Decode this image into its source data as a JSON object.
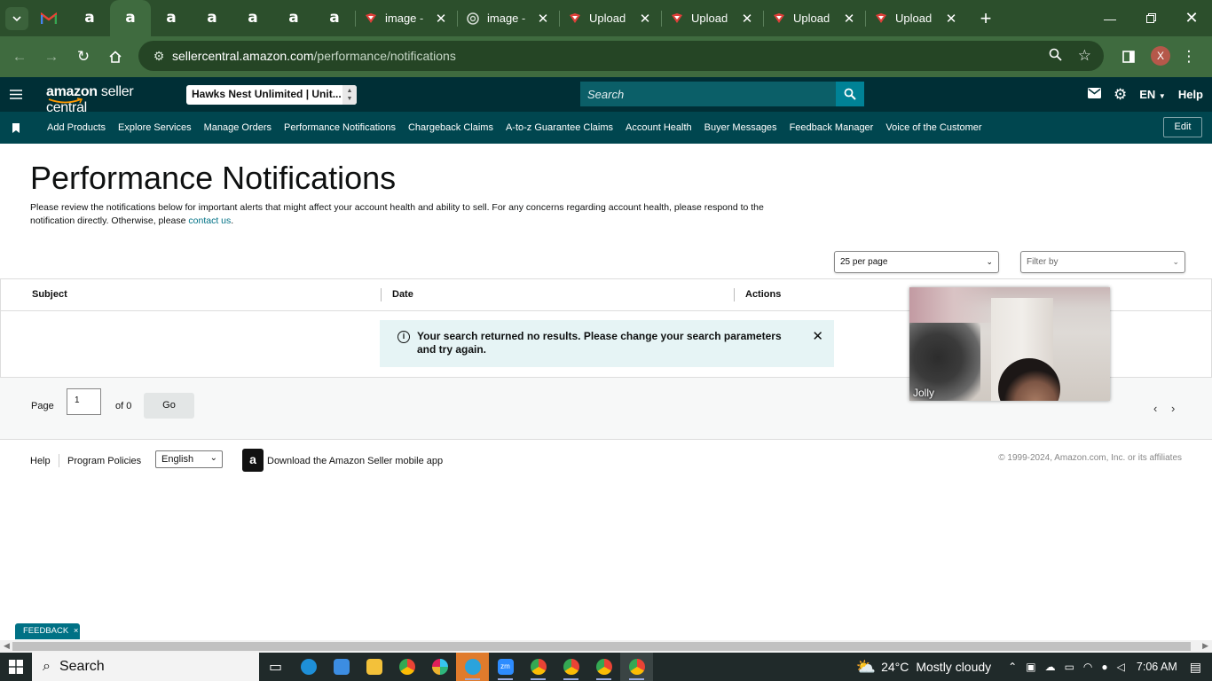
{
  "browser": {
    "tabs": [
      {
        "title": "image -",
        "favicon": "pinterest-icon"
      },
      {
        "title": "image -",
        "favicon": "openai-icon"
      },
      {
        "title": "Upload",
        "favicon": "upload-icon"
      },
      {
        "title": "Upload",
        "favicon": "upload-icon"
      },
      {
        "title": "Upload",
        "favicon": "upload-icon"
      },
      {
        "title": "Upload",
        "favicon": "upload-icon"
      }
    ],
    "url_host": "sellercentral.amazon.com",
    "url_path": "/performance/notifications",
    "profile_initial": "X"
  },
  "header": {
    "logo_bold": "amazon",
    "logo_light": " seller central",
    "store": "Hawks Nest Unlimited | Unit...",
    "search_placeholder": "Search",
    "language": "EN",
    "help": "Help"
  },
  "nav": {
    "items": [
      "Add Products",
      "Explore Services",
      "Manage Orders",
      "Performance Notifications",
      "Chargeback Claims",
      "A-to-z Guarantee Claims",
      "Account Health",
      "Buyer Messages",
      "Feedback Manager",
      "Voice of the Customer"
    ],
    "edit": "Edit"
  },
  "main": {
    "title": "Performance Notifications",
    "intro": "Please review the notifications below for important alerts that might affect your account health and ability to sell. For any concerns regarding account health, please respond to the notification directly. Otherwise, please ",
    "contact_link": "contact us",
    "per_page": "25 per page",
    "filter_placeholder": "Filter by",
    "columns": {
      "subject": "Subject",
      "date": "Date",
      "actions": "Actions"
    },
    "alert": "Your search returned no results. Please change your search parameters and try again."
  },
  "pager": {
    "page_label": "Page",
    "page_value": "1",
    "of_label": "of 0",
    "go": "Go"
  },
  "footer": {
    "help": "Help",
    "policies": "Program Policies",
    "language": "English",
    "app": "Download the Amazon Seller mobile app",
    "copyright": "© 1999-2024, Amazon.com, Inc. or its affiliates"
  },
  "video": {
    "participant": "Jolly"
  },
  "feedback": {
    "label": "FEEDBACK"
  },
  "taskbar": {
    "search": "Search",
    "temperature": "24°C",
    "weather": "Mostly cloudy",
    "time": "7:06 AM"
  }
}
